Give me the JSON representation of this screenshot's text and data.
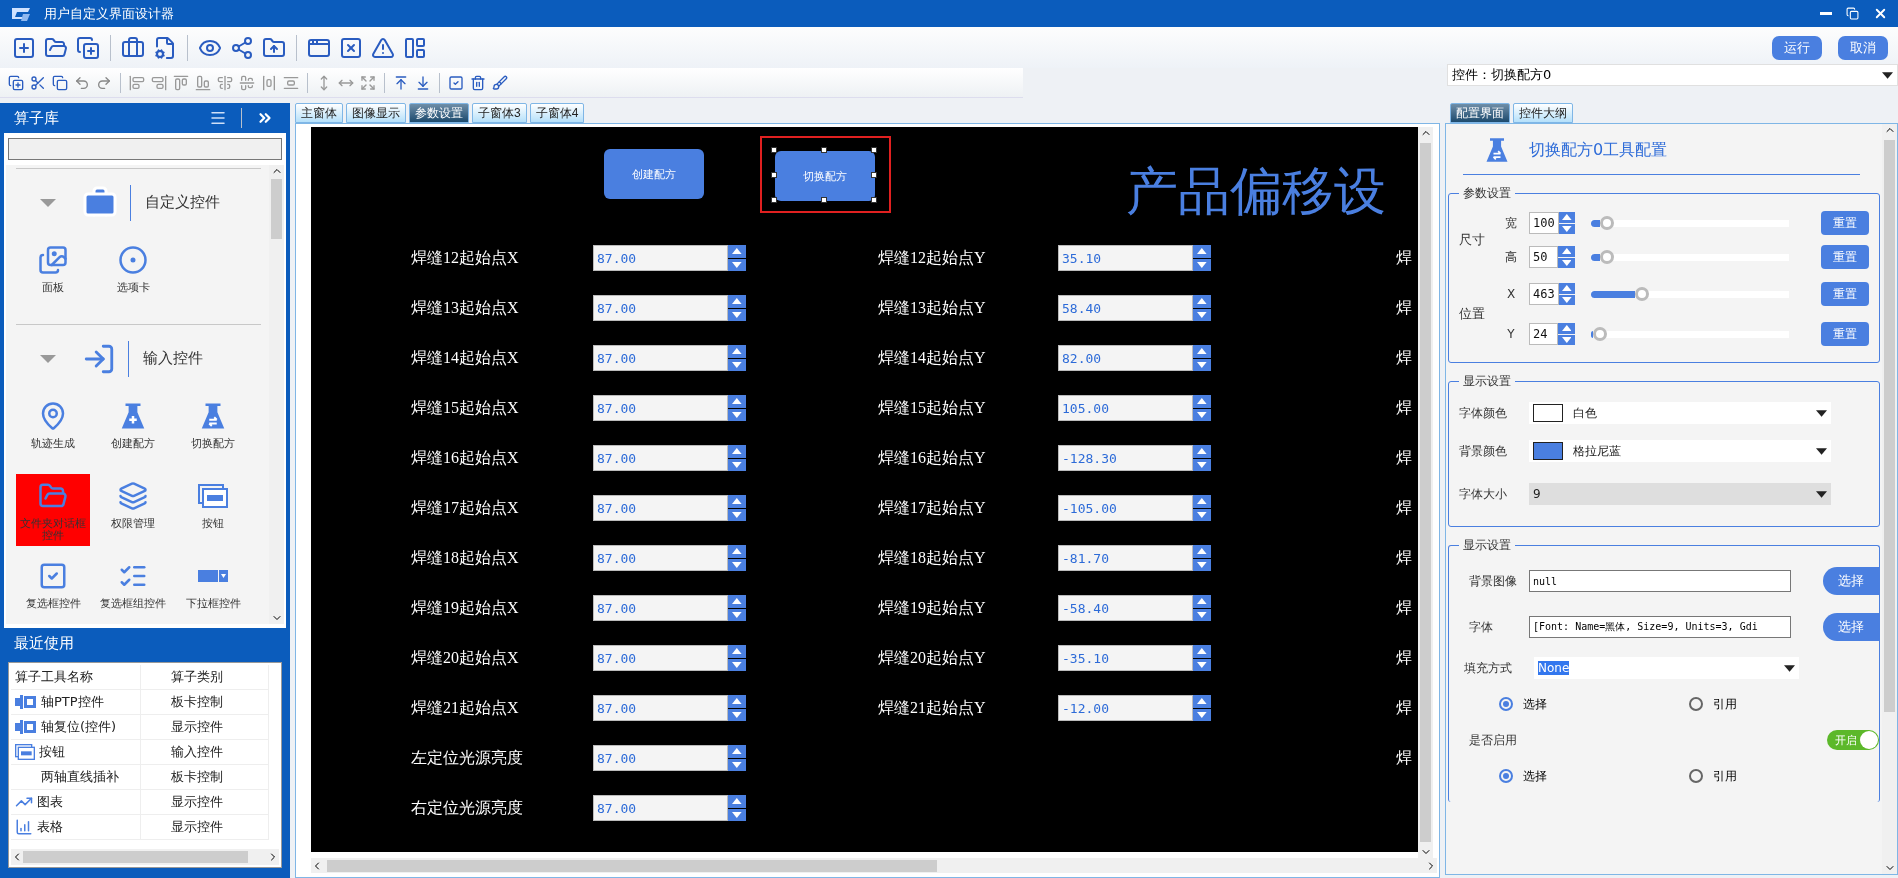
{
  "window": {
    "title": "用户自定义界面设计器"
  },
  "toolbar": {
    "buttons": [
      {
        "label": "运行"
      },
      {
        "label": "取消"
      }
    ]
  },
  "control_selector": {
    "value": "控件：切换配方0"
  },
  "library": {
    "title": "算子库",
    "groups": [
      {
        "name": "自定义控件",
        "expanded": true,
        "items": [
          {
            "label": "面板",
            "selected": false
          },
          {
            "label": "选项卡",
            "selected": false
          }
        ]
      },
      {
        "name": "输入控件",
        "expanded": true,
        "items": [
          {
            "label": "轨迹生成",
            "selected": false
          },
          {
            "label": "创建配方",
            "selected": false
          },
          {
            "label": "切换配方",
            "selected": false
          },
          {
            "label": "文件夹对话框控件",
            "selected": true
          },
          {
            "label": "权限管理",
            "selected": false
          },
          {
            "label": "按钮",
            "selected": false
          },
          {
            "label": "复选框控件",
            "selected": false
          },
          {
            "label": "复选框组控件",
            "selected": false
          },
          {
            "label": "下拉框控件",
            "selected": false
          }
        ]
      }
    ]
  },
  "recent": {
    "title": "最近使用",
    "columns": [
      "算子工具名称",
      "算子类别"
    ],
    "rows": [
      {
        "name": "轴PTP控件",
        "category": "板卡控制"
      },
      {
        "name": "轴复位(控件)",
        "category": "显示控件"
      },
      {
        "name": "按钮",
        "category": "输入控件"
      },
      {
        "name": "两轴直线插补",
        "category": "板卡控制"
      },
      {
        "name": "图表",
        "category": "显示控件"
      },
      {
        "name": "表格",
        "category": "显示控件"
      }
    ]
  },
  "tabs": [
    {
      "label": "主窗体",
      "selected": false
    },
    {
      "label": "图像显示",
      "selected": false
    },
    {
      "label": "参数设置",
      "selected": true
    },
    {
      "label": "子窗体3",
      "selected": false
    },
    {
      "label": "子窗体4",
      "selected": false
    }
  ],
  "canvas": {
    "buttons": [
      {
        "label": "创建配方",
        "selected": false
      },
      {
        "label": "切换配方",
        "selected": true
      }
    ],
    "title": "产品偏移设",
    "rows": [
      {
        "fields": [
          {
            "label": "焊缝12起始点X",
            "value": "87.00"
          },
          {
            "label": "焊缝12起始点Y",
            "value": "35.10"
          }
        ],
        "edge": "焊"
      },
      {
        "fields": [
          {
            "label": "焊缝13起始点X",
            "value": "87.00"
          },
          {
            "label": "焊缝13起始点Y",
            "value": "58.40"
          }
        ],
        "edge": "焊"
      },
      {
        "fields": [
          {
            "label": "焊缝14起始点X",
            "value": "87.00"
          },
          {
            "label": "焊缝14起始点Y",
            "value": "82.00"
          }
        ],
        "edge": "焊"
      },
      {
        "fields": [
          {
            "label": "焊缝15起始点X",
            "value": "87.00"
          },
          {
            "label": "焊缝15起始点Y",
            "value": "105.00"
          }
        ],
        "edge": "焊"
      },
      {
        "fields": [
          {
            "label": "焊缝16起始点X",
            "value": "87.00"
          },
          {
            "label": "焊缝16起始点Y",
            "value": "-128.30"
          }
        ],
        "edge": "焊"
      },
      {
        "fields": [
          {
            "label": "焊缝17起始点X",
            "value": "87.00"
          },
          {
            "label": "焊缝17起始点Y",
            "value": "-105.00"
          }
        ],
        "edge": "焊"
      },
      {
        "fields": [
          {
            "label": "焊缝18起始点X",
            "value": "87.00"
          },
          {
            "label": "焊缝18起始点Y",
            "value": "-81.70"
          }
        ],
        "edge": "焊"
      },
      {
        "fields": [
          {
            "label": "焊缝19起始点X",
            "value": "87.00"
          },
          {
            "label": "焊缝19起始点Y",
            "value": "-58.40"
          }
        ],
        "edge": "焊"
      },
      {
        "fields": [
          {
            "label": "焊缝20起始点X",
            "value": "87.00"
          },
          {
            "label": "焊缝20起始点Y",
            "value": "-35.10"
          }
        ],
        "edge": "焊"
      },
      {
        "fields": [
          {
            "label": "焊缝21起始点X",
            "value": "87.00"
          },
          {
            "label": "焊缝21起始点Y",
            "value": "-12.00"
          }
        ],
        "edge": "焊"
      },
      {
        "fields": [
          {
            "label": "左定位光源亮度",
            "value": "87.00"
          }
        ],
        "edge": "焊"
      },
      {
        "fields": [
          {
            "label": "右定位光源亮度",
            "value": "87.00"
          }
        ]
      }
    ]
  },
  "config": {
    "tabs": [
      {
        "label": "配置界面",
        "selected": true
      },
      {
        "label": "控件大纲",
        "selected": false
      }
    ],
    "title": "切换配方0工具配置",
    "params": {
      "legend": "参数设置",
      "groups": [
        {
          "label": "尺寸",
          "rows": [
            {
              "label": "宽",
              "value": "100",
              "level": 0.05,
              "button": "重置"
            },
            {
              "label": "高",
              "value": "50",
              "level": 0.05,
              "button": "重置"
            }
          ]
        },
        {
          "label": "位置",
          "rows": [
            {
              "label": "X",
              "value": "463",
              "level": 0.24,
              "button": "重置"
            },
            {
              "label": "Y",
              "value": "24",
              "level": 0.01,
              "button": "重置"
            }
          ]
        }
      ]
    },
    "display": {
      "legend": "显示设置",
      "rows": [
        {
          "kind": "color",
          "label": "字体颜色",
          "color": "#ffffff",
          "value": "白色"
        },
        {
          "kind": "color",
          "label": "背景颜色",
          "color": "#4a7fe0",
          "value": "格拉尼蓝"
        },
        {
          "kind": "size",
          "label": "字体大小",
          "value": "9"
        }
      ]
    },
    "display2": {
      "legend": "显示设置",
      "image": {
        "label": "背景图像",
        "value": "null",
        "button": "选择"
      },
      "font": {
        "label": "字体",
        "value": "[Font: Name=黑体, Size=9, Units=3, Gdi",
        "button": "选择"
      },
      "fill": {
        "label": "填充方式",
        "value": "None"
      },
      "radios": [
        {
          "label": "选择",
          "selected": true
        },
        {
          "label": "引用",
          "selected": false
        }
      ],
      "enabled": {
        "label": "是否启用",
        "on": true,
        "text": "开启"
      },
      "radios2": [
        {
          "label": "选择",
          "selected": true
        },
        {
          "label": "引用",
          "selected": false
        }
      ]
    }
  }
}
